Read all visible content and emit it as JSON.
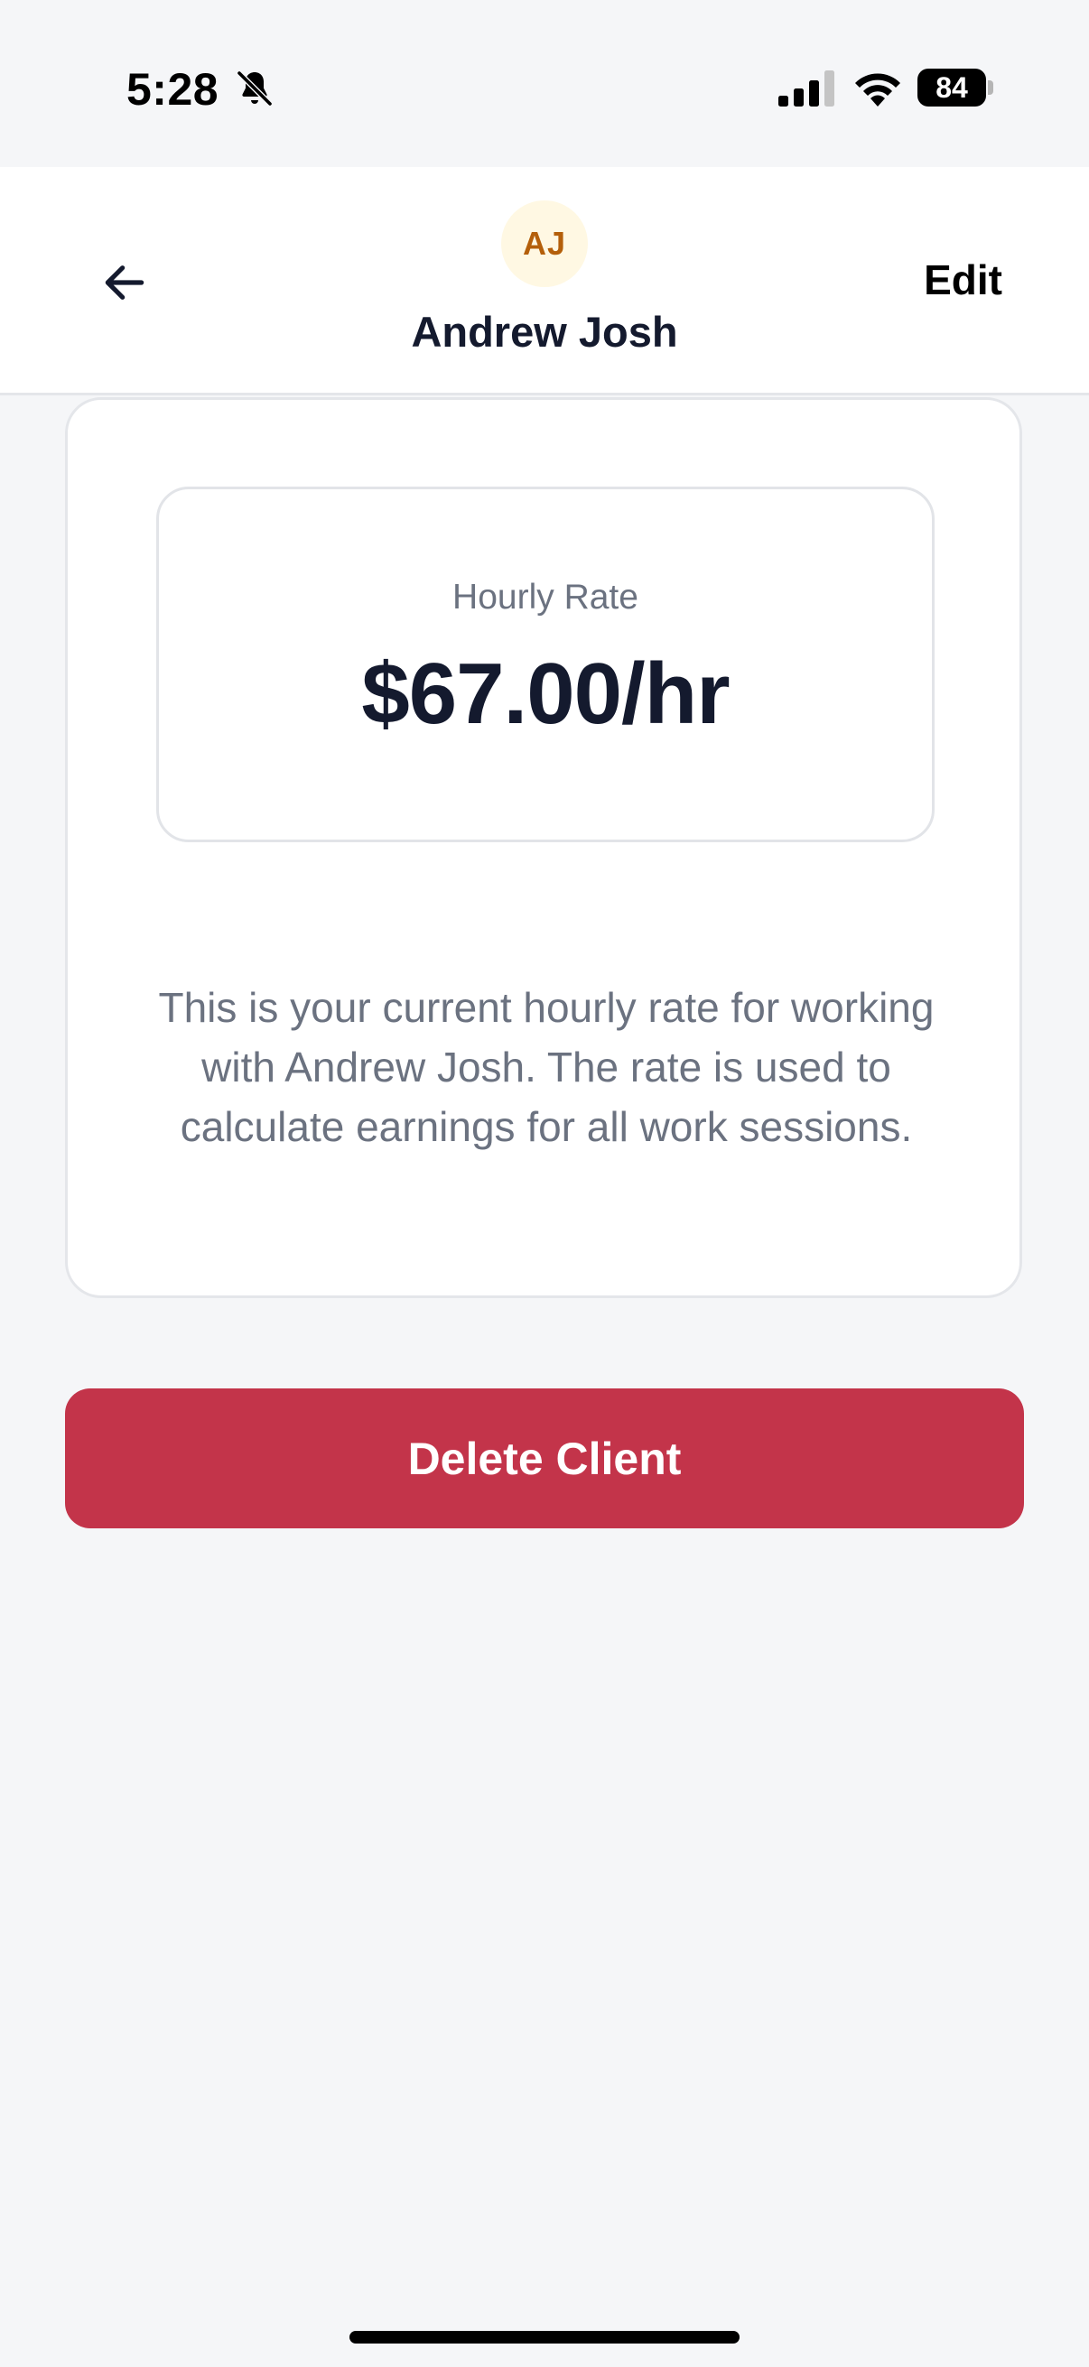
{
  "status_bar": {
    "time": "5:28",
    "battery_level": "84",
    "icons": [
      "bell-off-icon",
      "cellular-signal-icon",
      "wifi-icon",
      "battery-icon"
    ]
  },
  "header": {
    "back_icon": "arrow-left-icon",
    "avatar_initials": "AJ",
    "client_name": "Andrew Josh",
    "edit_label": "Edit"
  },
  "rate_card": {
    "label": "Hourly Rate",
    "value": "$67.00/hr",
    "description": "This is your current hourly rate for working with Andrew Josh. The rate is used to calculate earnings for all work sessions."
  },
  "actions": {
    "delete_label": "Delete Client"
  },
  "colors": {
    "background": "#f5f6f8",
    "avatar_bg": "#fff8e3",
    "avatar_text": "#b45f0a",
    "delete_button": "#c3344a",
    "primary_text": "#141a2e",
    "secondary_text": "#6b7280"
  }
}
